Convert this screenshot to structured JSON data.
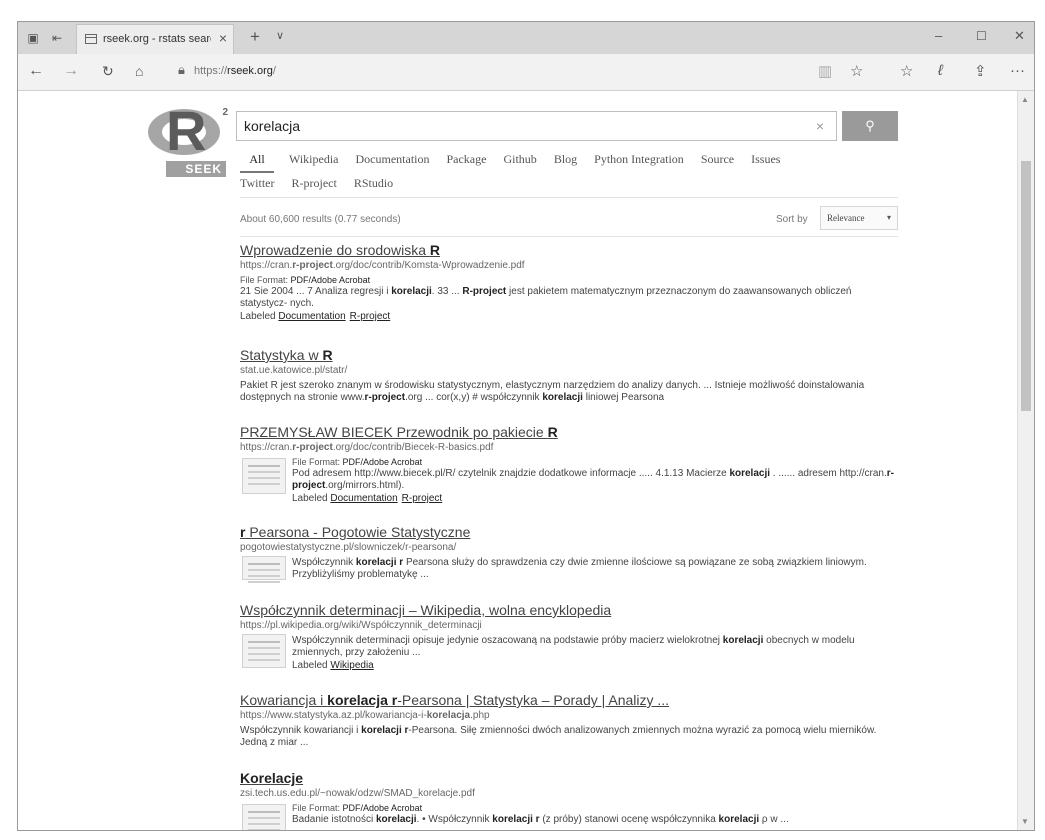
{
  "browser": {
    "tab_title": "rseek.org - rstats search",
    "url_prefix": "https://",
    "url_host": "rseek.org",
    "url_suffix": "/",
    "icons": {
      "tab_actions": "tab-actions-icon",
      "back_tabs": "back-tabs-icon",
      "page": "page-icon",
      "tab_close": "close-icon",
      "new_tab": "plus-icon",
      "tab_dropdown": "chevron-down-icon",
      "minimize": "minimize-icon",
      "maximize": "maximize-icon",
      "close": "close-icon",
      "back": "arrow-left-icon",
      "forward": "arrow-right-icon",
      "refresh": "refresh-icon",
      "home": "home-icon",
      "lock": "lock-icon",
      "reading_view": "reading-view-icon",
      "favorite": "star-icon",
      "favorites_hub": "favorites-hub-icon",
      "web_note": "pen-icon",
      "share": "share-icon",
      "more": "more-icon"
    }
  },
  "logo": {
    "letter": "R",
    "superscript": "2",
    "word": "SEEK"
  },
  "search": {
    "query": "korelacja",
    "clear": "×",
    "button_icon": "search-icon"
  },
  "filters_row1": [
    "All",
    "Wikipedia",
    "Documentation",
    "Package",
    "Github",
    "Blog",
    "Python Integration",
    "Source",
    "Issues"
  ],
  "filters_row2": [
    "Twitter",
    "R-project",
    "RStudio"
  ],
  "results_info": {
    "count": "About 60,600 results (0.77 seconds)",
    "sort_label": "Sort by",
    "sort_value": "Relevance"
  },
  "results": [
    {
      "title": "Wprowadzenie do srodowiska ",
      "title_bold": "R",
      "url_a": "https://cran.",
      "url_b": "r-project",
      "url_c": ".org/doc/contrib/Komsta-Wprowadzenie.pdf",
      "format_label": "File Format:",
      "format_value": "PDF/Adobe Acrobat",
      "snip_a": "21 Sie 2004 ... 7 Analiza regresji i ",
      "snip_b": "korelacji",
      "snip_c": ". 33 ... ",
      "snip_d": "R-project",
      "snip_e": " jest pakietem matematycznym przeznaczonym do zaawansowanych obliczeń statystycz- nych.",
      "label_prefix": "Labeled",
      "labels": [
        "Documentation",
        "R-project"
      ]
    },
    {
      "title": "Statystyka w ",
      "title_bold": "R",
      "url": "stat.ue.katowice.pl/statr/",
      "snip_a": "Pakiet R jest szeroko znanym w środowisku statystycznym, elastycznym narzędziem do analizy danych. ... Istnieje możliwość doinstalowania dostępnych na stronie www.",
      "snip_b": "r-project",
      "snip_c": ".org ... cor(x,y) # współczynnik ",
      "snip_d": "korelacji",
      "snip_e": " liniowej Pearsona"
    },
    {
      "title": "PRZEMYSŁAW BIECEK Przewodnik po pakiecie ",
      "title_bold": "R",
      "url_a": "https://cran.",
      "url_b": "r-project",
      "url_c": ".org/doc/contrib/Biecek-R-basics.pdf",
      "format_label": "File Format:",
      "format_value": "PDF/Adobe Acrobat",
      "snip_a": "Pod adresem http://www.biecek.pl/R/ czytelnik znajdzie dodatkowe informacje ..... 4.1.13 Macierze ",
      "snip_b": "korelacji",
      "snip_c": " . ...... adresem http://cran.",
      "snip_d": "r-project",
      "snip_e": ".org/mirrors.html).",
      "label_prefix": "Labeled",
      "labels": [
        "Documentation",
        "R-project"
      ]
    },
    {
      "title_bold": "r",
      "title": " Pearsona - Pogotowie Statystyczne",
      "url": "pogotowiestatystyczne.pl/slowniczek/r-pearsona/",
      "snip_a": "Współczynnik ",
      "snip_b": "korelacji r",
      "snip_c": " Pearsona służy do sprawdzenia czy dwie zmienne ilościowe są powiązane ze sobą związkiem liniowym. Przybliżyliśmy problematykę ..."
    },
    {
      "title": "Współczynnik determinacji – Wikipedia, wolna encyklopedia",
      "url": "https://pl.wikipedia.org/wiki/Współczynnik_determinacji",
      "snip_a": "Współczynnik determinacji opisuje jedynie oszacowaną na podstawie próby macierz wielokrotnej ",
      "snip_b": "korelacji",
      "snip_c": " obecnych w modelu zmiennych, przy założeniu ...",
      "label_prefix": "Labeled",
      "labels": [
        "Wikipedia"
      ]
    },
    {
      "title_a": "Kowariancja i ",
      "title_b": "korelacja r",
      "title_c": "-Pearsona | Statystyka – Porady | Analizy ...",
      "url_a": "https://www.statystyka.az.pl/kowariancja-i-",
      "url_b": "korelacja",
      "url_c": ".php",
      "snip_a": "Współczynnik kowariancji i ",
      "snip_b": "korelacji r",
      "snip_c": "-Pearsona. Siłę zmienności dwóch analizowanych zmiennych można wyrazić za pomocą wielu mierników. Jedną z miar ..."
    },
    {
      "title_bold": "Korelacje",
      "url": "zsi.tech.us.edu.pl/~nowak/odzw/SMAD_korelacje.pdf",
      "format_label": "File Format:",
      "format_value": "PDF/Adobe Acrobat",
      "snip_a": "Badanie istotności ",
      "snip_b": "korelacji",
      "snip_c": ". • Współczynnik ",
      "snip_d": "korelacji r",
      "snip_e": " (z próby) stanowi ocenę współczynnika ",
      "snip_f": "korelacji",
      "snip_g": " ρ w ..."
    }
  ]
}
